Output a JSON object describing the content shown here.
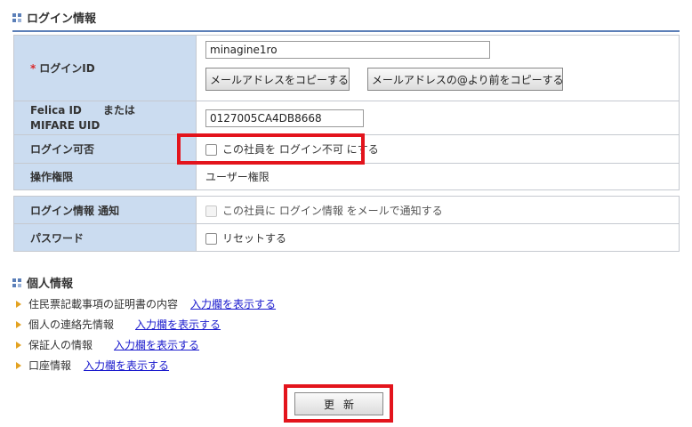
{
  "login_section": {
    "title": "ログイン情報",
    "login_id_label": "ログインID",
    "required_mark": "*",
    "login_id_value": "minagine1ro",
    "copy_email_button": "メールアドレスをコピーする",
    "copy_email_local_button": "メールアドレスの@より前をコピーする",
    "felica_label_line1": "Felica ID　　または",
    "felica_label_line2": "MIFARE UID",
    "felica_value": "0127005CA4DB8668",
    "login_permission_label": "ログイン可否",
    "login_permission_text": "この社員を ログイン不可 にする",
    "authority_label": "操作権限",
    "authority_value": "ユーザー権限",
    "notify_label": "ログイン情報 通知",
    "notify_text": "この社員に ログイン情報 をメールで通知する",
    "password_label": "パスワード",
    "password_reset_text": "リセットする"
  },
  "personal_section": {
    "title": "個人情報",
    "items": [
      {
        "label": "住民票記載事項の証明書の内容",
        "link": "入力欄を表示する"
      },
      {
        "label": "個人の連絡先情報",
        "link": "入力欄を表示する"
      },
      {
        "label": "保証人の情報",
        "link": "入力欄を表示する"
      },
      {
        "label": "口座情報",
        "link": "入力欄を表示する"
      }
    ]
  },
  "update_button": "更新",
  "colors": {
    "label_bg": "#cbdcf0",
    "highlight": "#e3141c",
    "link": "#1a1acd",
    "bullet": "#e3a221"
  }
}
